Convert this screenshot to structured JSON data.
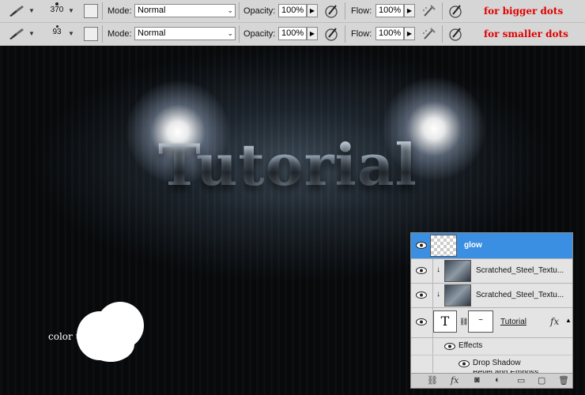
{
  "toolbar_rows": [
    {
      "brush_size": "370",
      "mode_label": "Mode:",
      "mode_value": "Normal",
      "opacity_label": "Opacity:",
      "opacity_value": "100%",
      "flow_label": "Flow:",
      "flow_value": "100%",
      "note": "for bigger dots"
    },
    {
      "brush_size": "93",
      "mode_label": "Mode:",
      "mode_value": "Normal",
      "opacity_label": "Opacity:",
      "opacity_value": "100%",
      "flow_label": "Flow:",
      "flow_value": "100%",
      "note": "for smaller dots"
    }
  ],
  "canvas": {
    "title_text": "Tutorial",
    "color_label": "color used:",
    "color_swatch": "#ffffff"
  },
  "layers_panel": {
    "layers": [
      {
        "name": "glow",
        "selected": true
      },
      {
        "name": "Scratched_Steel_Textu...",
        "selected": false
      },
      {
        "name": "Scratched_Steel_Textu...",
        "selected": false
      },
      {
        "name": "Tutorial",
        "selected": false
      }
    ],
    "effects_label": "Effects",
    "effects": [
      "Drop Shadow",
      "Bevel and Emboss"
    ],
    "fx_label": "fx"
  },
  "colors": {
    "note_red": "#e00000",
    "selection_blue": "#3b8fe2"
  }
}
